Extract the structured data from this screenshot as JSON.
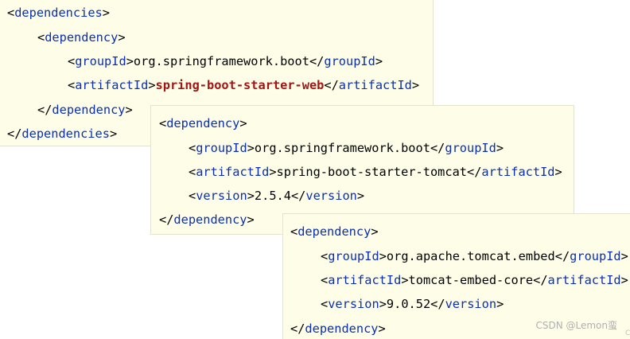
{
  "snippet_1": {
    "l1": {
      "open": "<",
      "name": "dependencies",
      "close": ">"
    },
    "l2": {
      "open": "<",
      "name": "dependency",
      "close": ">"
    },
    "l3": {
      "open_lt": "<",
      "open_name": "groupId",
      "open_gt": ">",
      "value": "org.springframework.boot",
      "close_lt": "</",
      "close_name": "groupId",
      "close_gt": ">"
    },
    "l4": {
      "open_lt": "<",
      "open_name": "artifactId",
      "open_gt": ">",
      "value": "spring-boot-starter-web",
      "close_lt": "</",
      "close_name": "artifactId",
      "close_gt": ">"
    },
    "l5": {
      "open": "</",
      "name": "dependency",
      "close": ">"
    },
    "l6": {
      "open": "</",
      "name": "dependencies",
      "close": ">"
    }
  },
  "snippet_2": {
    "l1": {
      "open": "<",
      "name": "dependency",
      "close": ">"
    },
    "l2": {
      "open_lt": "<",
      "open_name": "groupId",
      "open_gt": ">",
      "value": "org.springframework.boot",
      "close_lt": "</",
      "close_name": "groupId",
      "close_gt": ">"
    },
    "l3": {
      "open_lt": "<",
      "open_name": "artifactId",
      "open_gt": ">",
      "value": "spring-boot-starter-tomcat",
      "close_lt": "</",
      "close_name": "artifactId",
      "close_gt": ">"
    },
    "l4": {
      "open_lt": "<",
      "open_name": "version",
      "open_gt": ">",
      "value": "2.5.4",
      "close_lt": "</",
      "close_name": "version",
      "close_gt": ">"
    },
    "l5": {
      "open": "</",
      "name": "dependency",
      "close": ">"
    }
  },
  "snippet_3": {
    "l1": {
      "open": "<",
      "name": "dependency",
      "close": ">"
    },
    "l2": {
      "open_lt": "<",
      "open_name": "groupId",
      "open_gt": ">",
      "value": "org.apache.tomcat.embed",
      "close_lt": "</",
      "close_name": "groupId",
      "close_gt": ">"
    },
    "l3": {
      "open_lt": "<",
      "open_name": "artifactId",
      "open_gt": ">",
      "value": "tomcat-embed-core",
      "close_lt": "</",
      "close_name": "artifactId",
      "close_gt": ">"
    },
    "l4": {
      "open_lt": "<",
      "open_name": "version",
      "open_gt": ">",
      "value": "9.0.52",
      "close_lt": "</",
      "close_name": "version",
      "close_gt": ">"
    },
    "l5": {
      "open": "</",
      "name": "dependency",
      "close": ">"
    }
  },
  "watermark": "CSDN @Lemon蛮",
  "watermark_cut": "CS",
  "colors": {
    "tag": "#0b2fb0",
    "highlight_value": "#a31515",
    "panel_bg": "#fdfde8"
  }
}
